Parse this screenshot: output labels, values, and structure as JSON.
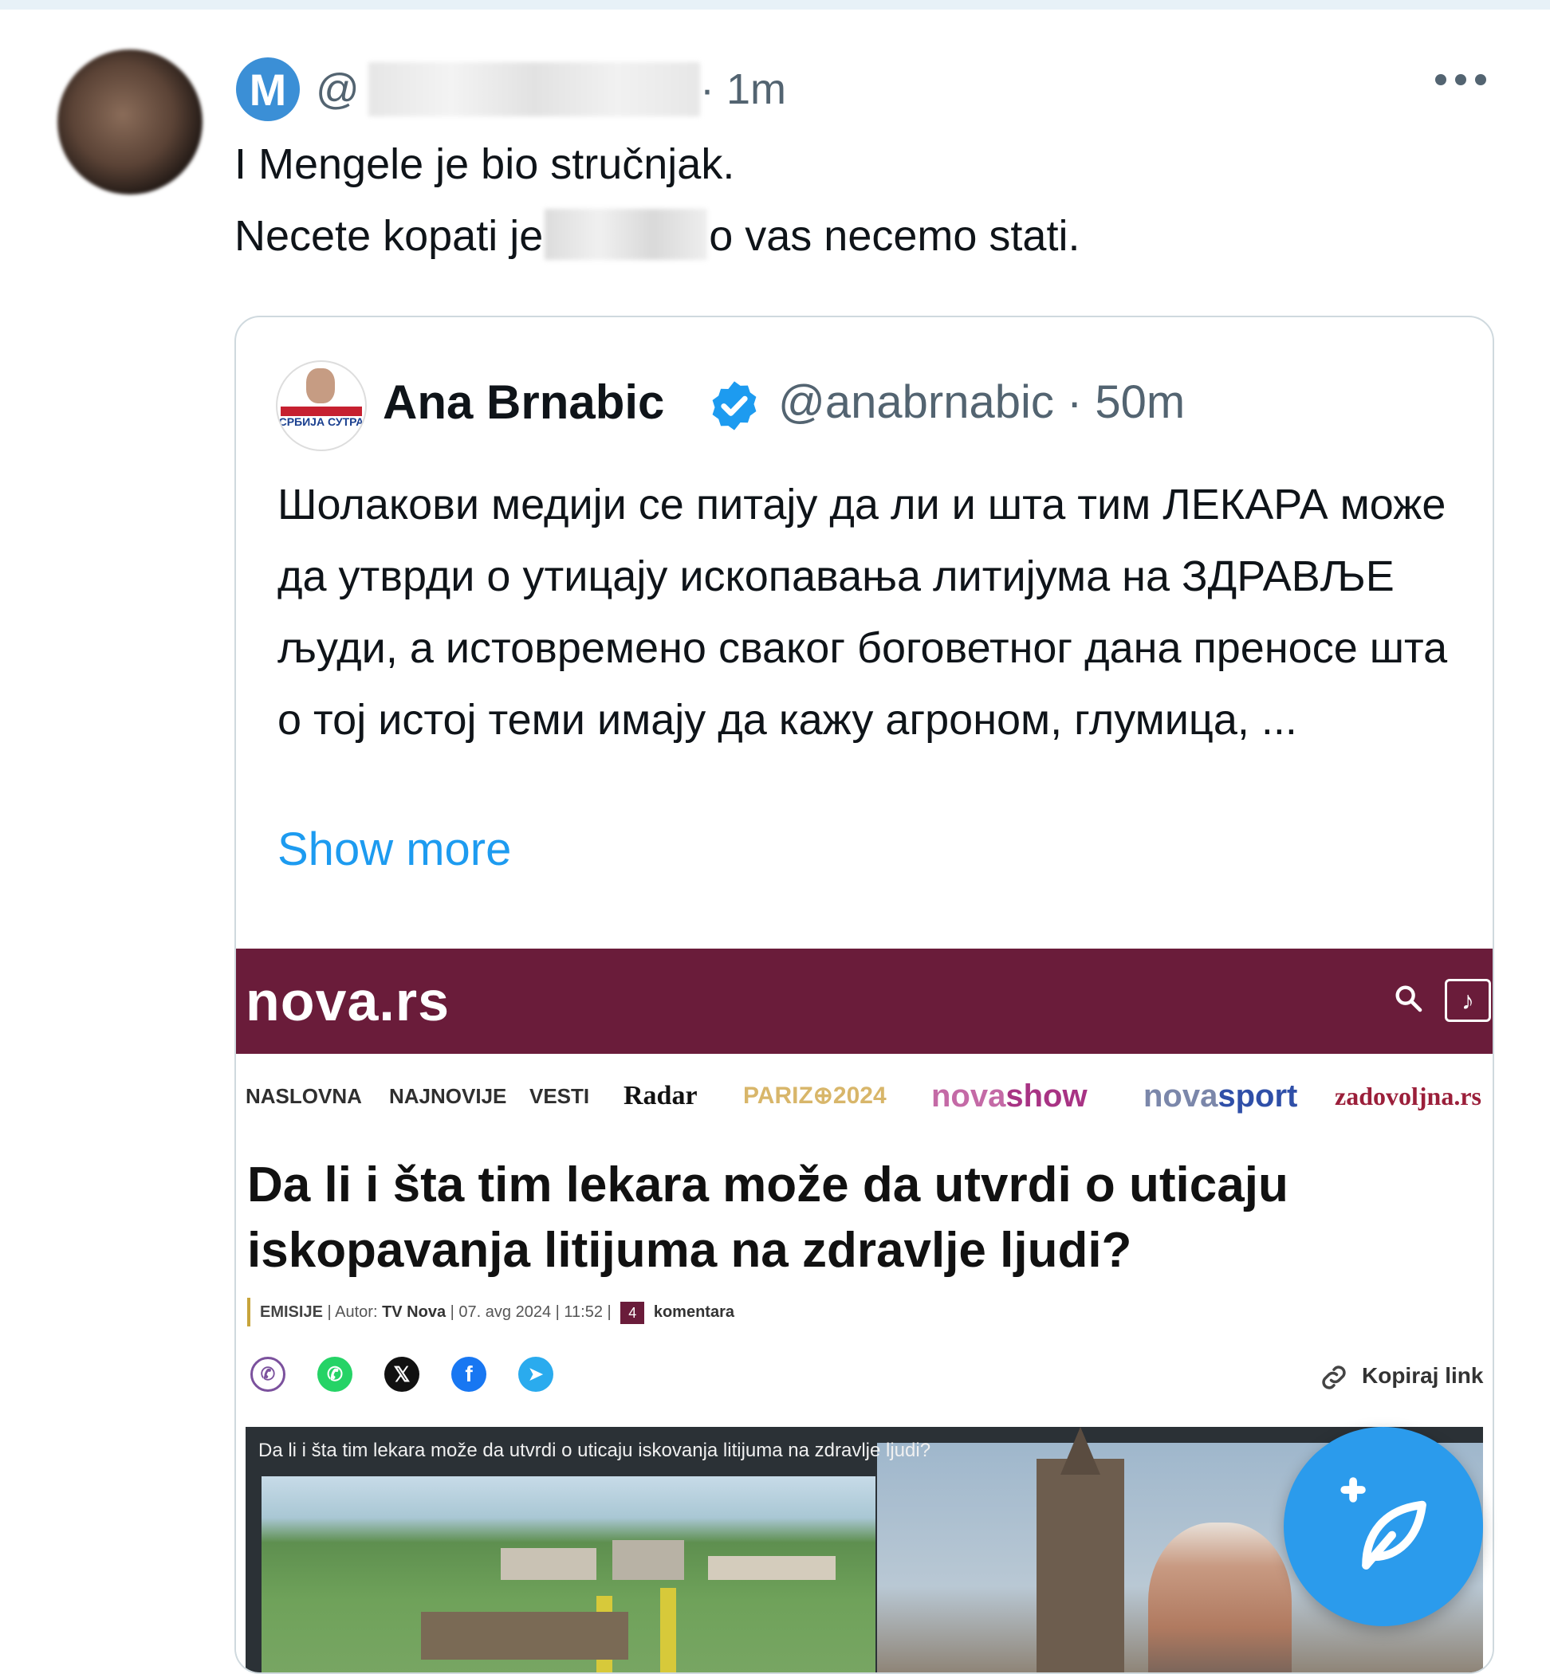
{
  "reply": {
    "badge_letter": "M",
    "handle_prefix": "@",
    "time": "· 1m",
    "line1": "I Mengele je bio stručnjak.",
    "line2_start": "Necete kopati je",
    "line2_end": "o vas necemo stati."
  },
  "quote": {
    "avatar_text": "СРБИЈА СУТРА",
    "name": "Ana Brnabic",
    "handle_time": "@anabrnabic · 50m",
    "text": "Шолакови медији се питају да ли и шта тим ЛЕКАРА може да утврди о утицају ископавања литијума на ЗДРАВЉЕ људи, а истовремено сваког боговетног дана преносе шта о тој истој теми имају да кажу агроном, глумица, ...",
    "show_more": "Show more"
  },
  "nova": {
    "logo": "nova.rs",
    "music_icon": "♪",
    "nav": {
      "naslovna": "NASLOVNA",
      "najnovije": "NAJNOVIJE",
      "vesti": "VESTI",
      "radar": "Radar",
      "pariz": "PARIZ⊕2024",
      "novashow_a": "nova",
      "novashow_b": "show",
      "novasport_a": "nova",
      "novasport_b": "sport",
      "zadovoljna": "zadovoljna.rs"
    },
    "headline": "Da li i šta tim lekara može da utvrdi o uticaju iskopavanja litijuma na zdravlje ljudi?",
    "meta": {
      "category": "EMISIJE",
      "author_label": "Autor:",
      "author": "TV Nova",
      "date": "07. avg 2024 | 11:52",
      "comment_count": "4",
      "comments": "komentara"
    },
    "copy_link": "Kopiraj link",
    "video_caption": "Da li i šta tim lekara može da utvrdi o uticaju iskovanja litijuma na zdravlje ljudi?"
  },
  "icons": {
    "reply_menu": "more-dots-icon",
    "verified": "verified-badge-icon",
    "search": "search-icon",
    "compose": "compose-tweet-icon"
  },
  "colors": {
    "twitter_blue": "#1d9bf0",
    "nova_header": "#6a1c3a",
    "secondary_text": "#536471"
  }
}
